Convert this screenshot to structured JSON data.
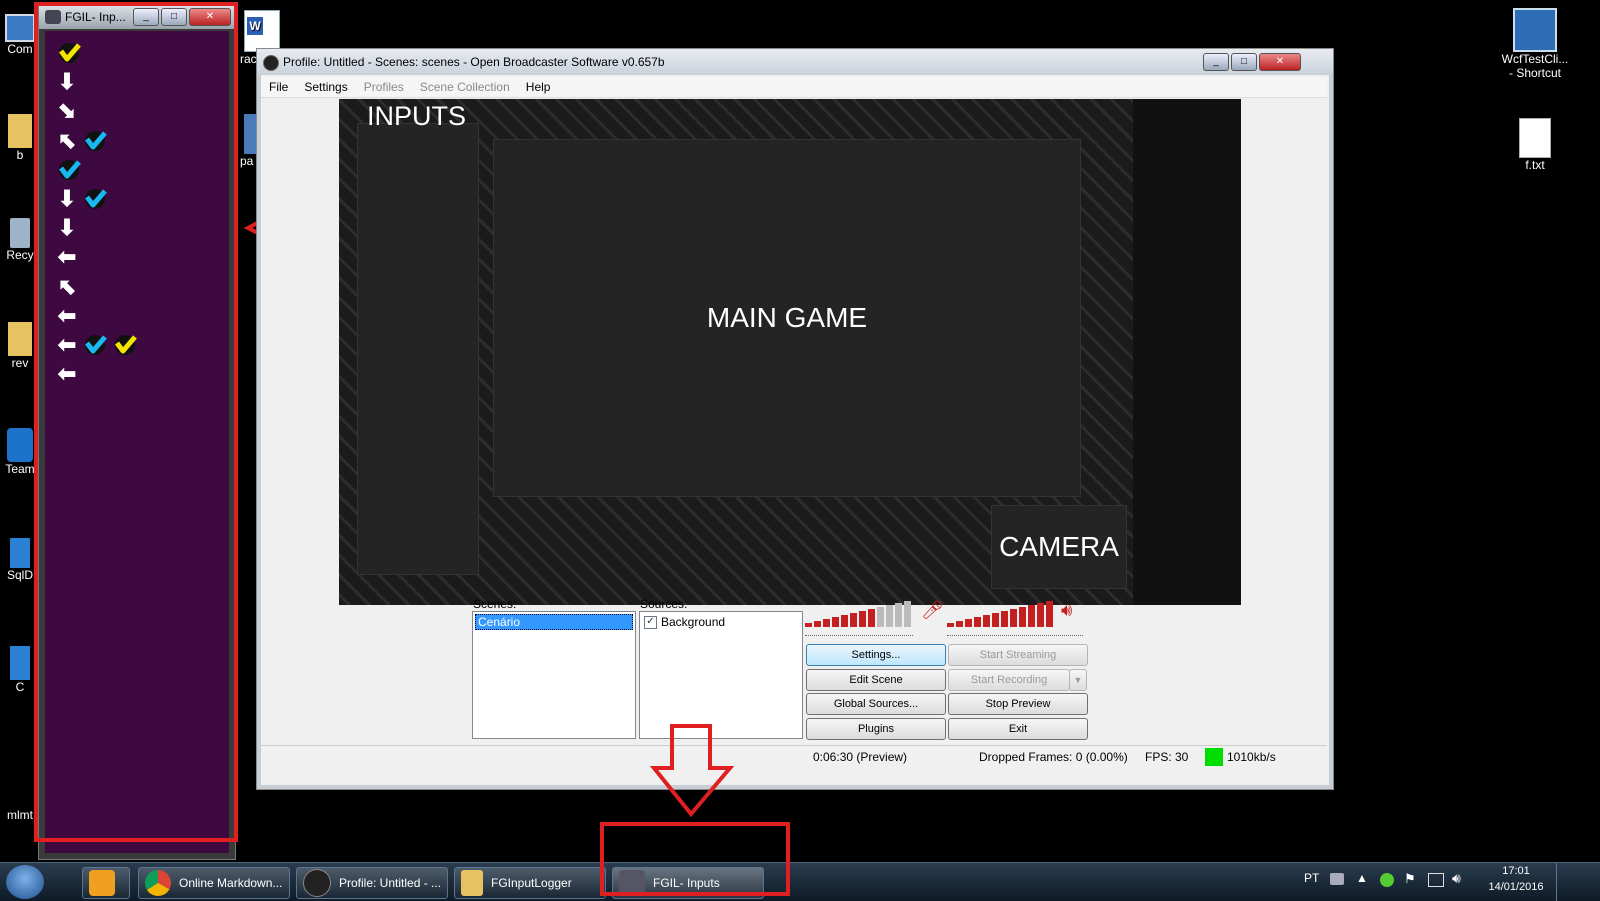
{
  "desktop": {
    "icons_left": [
      {
        "label": "Com"
      },
      {
        "label": "b"
      },
      {
        "label": "Recy"
      },
      {
        "label": "rev"
      },
      {
        "label": "Team"
      },
      {
        "label": "SqlD"
      },
      {
        "label": "C"
      },
      {
        "label": "mlmt"
      }
    ],
    "icons_mid": [
      {
        "label": "rac"
      },
      {
        "label": "pa"
      }
    ],
    "icons_right": [
      {
        "label": "WcfTestCli...\n- Shortcut"
      },
      {
        "label": "f.txt"
      }
    ]
  },
  "fgil": {
    "title": "FGIL- Inp...",
    "background": "#3e0840",
    "rows": [
      {
        "items": [
          "btn-yellow-M"
        ]
      },
      {
        "items": [
          "down"
        ]
      },
      {
        "items": [
          "down-right"
        ]
      },
      {
        "items": [
          "up-left",
          "btn-blue-L"
        ]
      },
      {
        "items": [
          "btn-blue-L"
        ]
      },
      {
        "items": [
          "down",
          "btn-blue-L"
        ]
      },
      {
        "items": [
          "down"
        ]
      },
      {
        "items": [
          "left"
        ]
      },
      {
        "items": [
          "up-left"
        ]
      },
      {
        "items": [
          "left"
        ]
      },
      {
        "items": [
          "left",
          "btn-blue-L",
          "btn-yellow-M"
        ]
      },
      {
        "items": [
          "left"
        ]
      }
    ]
  },
  "obs": {
    "title": "Profile: Untitled - Scenes: scenes - Open Broadcaster Software v0.657b",
    "menu": [
      {
        "label": "File",
        "enabled": true
      },
      {
        "label": "Settings",
        "enabled": true
      },
      {
        "label": "Profiles",
        "enabled": false
      },
      {
        "label": "Scene Collection",
        "enabled": false
      },
      {
        "label": "Help",
        "enabled": true
      }
    ],
    "preview": {
      "inputs_label": "INPUTS",
      "main_label": "MAIN GAME",
      "camera_label": "CAMERA"
    },
    "scenes_label": "Scenes:",
    "scenes": [
      "Cenário"
    ],
    "sources_label": "Sources:",
    "sources": [
      {
        "label": "Background",
        "checked": true
      }
    ],
    "buttons": {
      "settings": "Settings...",
      "start_streaming": "Start Streaming",
      "edit_scene": "Edit Scene",
      "start_recording": "Start Recording",
      "global_sources": "Global Sources...",
      "stop_preview": "Stop Preview",
      "plugins": "Plugins",
      "exit": "Exit"
    },
    "mic_level": 0.7,
    "desktop_level": 1.0,
    "status": {
      "time": "0:06:30 (Preview)",
      "dropped": "Dropped Frames: 0 (0.00%)",
      "fps": "FPS: 30",
      "bitrate": "1010kb/s",
      "bitrate_color": "#00dd00"
    }
  },
  "taskbar": {
    "start_icon": "windows-orb-icon",
    "buttons": [
      {
        "label": "",
        "icon": "outlook-icon"
      },
      {
        "label": "Online Markdown...",
        "icon": "chrome-icon"
      },
      {
        "label": "Profile: Untitled - ...",
        "icon": "obs-icon"
      },
      {
        "label": "FGInputLogger",
        "icon": "folder-icon"
      },
      {
        "label": "FGIL- Inputs",
        "icon": "joystick-icon"
      }
    ],
    "tray": {
      "language": "PT",
      "time": "17:01",
      "date": "14/01/2016"
    }
  },
  "colors": {
    "annotation_red": "#e02020",
    "taskbar": "#1a2c3c"
  }
}
